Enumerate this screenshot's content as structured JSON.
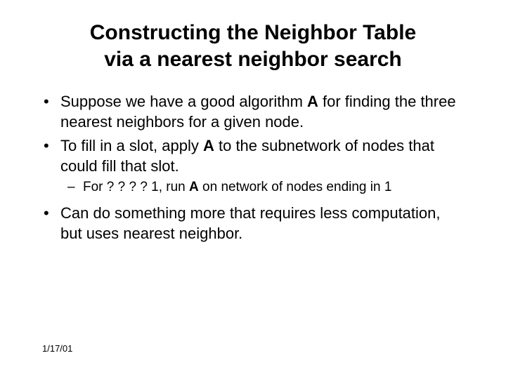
{
  "title_line1": "Constructing the Neighbor Table",
  "title_line2": "via a nearest neighbor search",
  "bullets": {
    "b1_pre": "Suppose we have a good algorithm ",
    "b1_algo": "A",
    "b1_post": " for finding the three nearest neighbors for a given node.",
    "b2_pre": "To fill in a slot, apply ",
    "b2_algo": "A",
    "b2_post": " to the subnetwork of nodes that could fill that slot.",
    "b2_sub_pre": "For ? ? ? ? 1, run ",
    "b2_sub_algo": "A",
    "b2_sub_post": " on network of nodes ending in 1",
    "b3": "Can do something more that requires less computation, but uses nearest neighbor."
  },
  "footer_date": "1/17/01"
}
